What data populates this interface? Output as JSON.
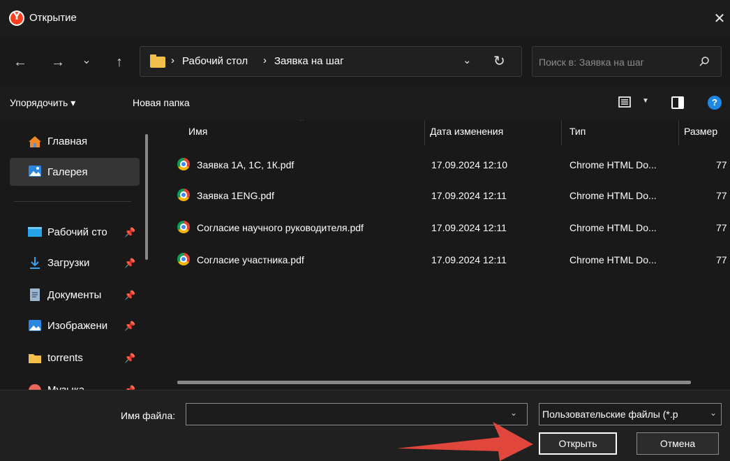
{
  "window": {
    "title": "Открытие",
    "close": "✕"
  },
  "nav": {
    "back": "←",
    "forward": "→",
    "recent": "⌄",
    "up": "↑",
    "breadcrumbs": [
      "Рабочий стол",
      "Заявка на шаг"
    ],
    "sep": "›",
    "dropdown": "⌄",
    "refresh": "↻",
    "search_placeholder": "Поиск в: Заявка на шаг"
  },
  "toolbar": {
    "organize": "Упорядочить ▾",
    "new_folder": "Новая папка",
    "help": "?"
  },
  "sidebar": {
    "items": [
      {
        "label": "Главная",
        "icon": "home-icon",
        "pinned": false,
        "selected": false
      },
      {
        "label": "Галерея",
        "icon": "gallery-icon",
        "pinned": false,
        "selected": true
      },
      {
        "label": "Рабочий сто",
        "icon": "desktop-icon",
        "pinned": true,
        "selected": false
      },
      {
        "label": "Загрузки",
        "icon": "download-icon",
        "pinned": true,
        "selected": false
      },
      {
        "label": "Документы",
        "icon": "document-icon",
        "pinned": true,
        "selected": false
      },
      {
        "label": "Изображени",
        "icon": "pictures-icon",
        "pinned": true,
        "selected": false
      },
      {
        "label": "torrents",
        "icon": "folder-icon",
        "pinned": true,
        "selected": false
      },
      {
        "label": "Музыка",
        "icon": "music-icon",
        "pinned": true,
        "selected": false
      }
    ]
  },
  "columns": {
    "name": "Имя",
    "date": "Дата изменения",
    "type": "Тип",
    "size": "Размер"
  },
  "files": [
    {
      "name": "Заявка 1А, 1С, 1К.pdf",
      "date": "17.09.2024 12:10",
      "type": "Chrome HTML Do...",
      "size": "77"
    },
    {
      "name": "Заявка 1ENG.pdf",
      "date": "17.09.2024 12:11",
      "type": "Chrome HTML Do...",
      "size": "77"
    },
    {
      "name": "Согласие  научного руководителя.pdf",
      "date": "17.09.2024 12:11",
      "type": "Chrome HTML Do...",
      "size": "77"
    },
    {
      "name": "Согласие участника.pdf",
      "date": "17.09.2024 12:11",
      "type": "Chrome HTML Do...",
      "size": "77"
    }
  ],
  "bottom": {
    "filename_label": "Имя файла:",
    "filename_value": "",
    "filetype": "Пользовательские файлы (*.p",
    "open": "Открыть",
    "cancel": "Отмена"
  },
  "colors": {
    "annotation_arrow": "#e0463b",
    "accent": "#1f88e5"
  }
}
